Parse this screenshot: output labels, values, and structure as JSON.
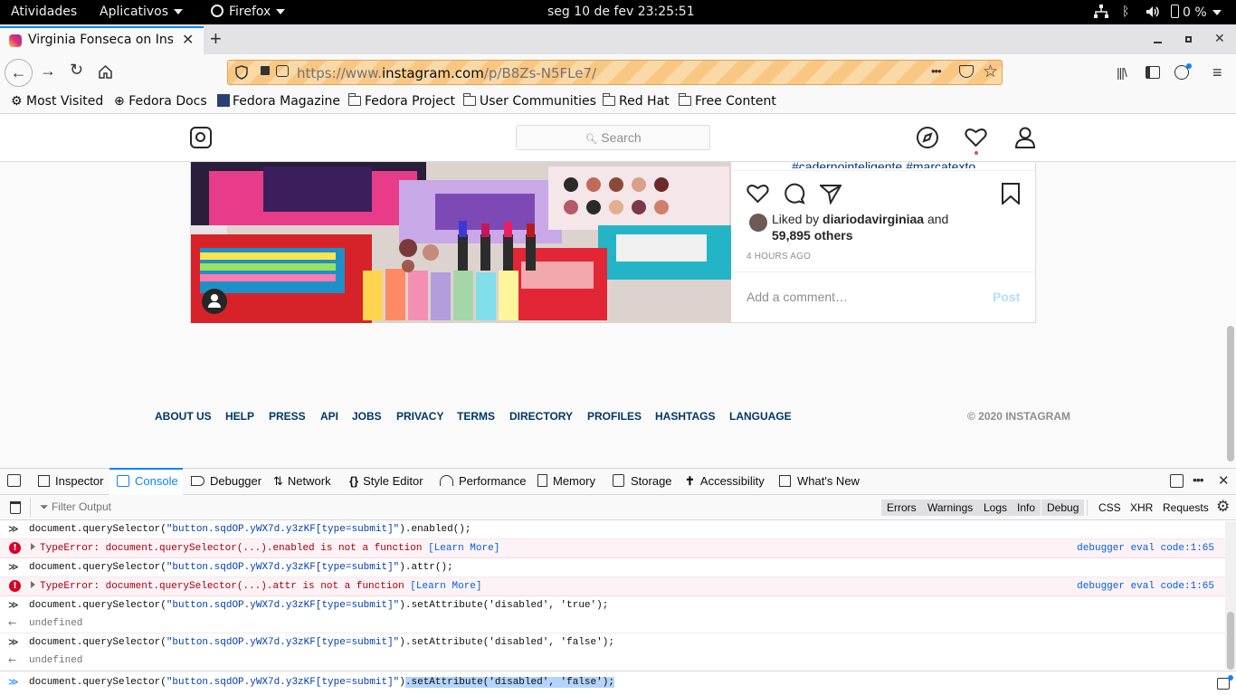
{
  "system_bar": {
    "activities": "Atividades",
    "applications": "Aplicativos",
    "app": "Firefox",
    "clock": "seg 10 de fev  23:25:51",
    "battery": "0 %"
  },
  "browser": {
    "tab_title": "Virginia Fonseca on Insta",
    "url_prefix": "https://www.",
    "url_domain": "instagram.com",
    "url_path": "/p/B8Zs-N5FLe7/",
    "page_actions": "•••",
    "bookmarks": [
      "Most Visited",
      "Fedora Docs",
      "Fedora Magazine",
      "Fedora Project",
      "User Communities",
      "Red Hat",
      "Free Content"
    ]
  },
  "instagram": {
    "search_placeholder": "Search",
    "caption_fragment": "#cadernointeligente #marcatexto",
    "liked_by_prefix": "Liked by ",
    "liked_by_user": "diariodavirginiaa",
    "liked_by_and": " and",
    "likes_others": "59,895 others",
    "timestamp": "4 HOURS AGO",
    "comment_placeholder": "Add a comment…",
    "post_button": "Post",
    "footer_links": [
      "ABOUT US",
      "HELP",
      "PRESS",
      "API",
      "JOBS",
      "PRIVACY",
      "TERMS",
      "DIRECTORY",
      "PROFILES",
      "HASHTAGS",
      "LANGUAGE"
    ],
    "copyright": "© 2020 INSTAGRAM"
  },
  "devtools": {
    "tabs": [
      "Inspector",
      "Console",
      "Debugger",
      "Network",
      "Style Editor",
      "Performance",
      "Memory",
      "Storage",
      "Accessibility",
      "What's New"
    ],
    "active_tab": "Console",
    "filter_placeholder": "Filter Output",
    "filter_buttons": [
      "Errors",
      "Warnings",
      "Logs",
      "Info",
      "Debug"
    ],
    "request_buttons": [
      "CSS",
      "XHR",
      "Requests"
    ],
    "console": [
      {
        "kind": "input",
        "pre": "document.querySelector(",
        "str": "\"button.sqdOP.yWX7d.y3zKF[type=submit]\"",
        "post": ").enabled();"
      },
      {
        "kind": "error",
        "text": "TypeError: document.querySelector(...).enabled is not a function",
        "learn": "[Learn More]",
        "location": "debugger eval code:1:65"
      },
      {
        "kind": "input",
        "pre": "document.querySelector(",
        "str": "\"button.sqdOP.yWX7d.y3zKF[type=submit]\"",
        "post": ").attr();"
      },
      {
        "kind": "error",
        "text": "TypeError: document.querySelector(...).attr is not a function",
        "learn": "[Learn More]",
        "location": "debugger eval code:1:65"
      },
      {
        "kind": "input",
        "pre": "document.querySelector(",
        "str": "\"button.sqdOP.yWX7d.y3zKF[type=submit]\"",
        "post": ").setAttribute('disabled', 'true');"
      },
      {
        "kind": "output",
        "text": "undefined"
      },
      {
        "kind": "input",
        "pre": "document.querySelector(",
        "str": "\"button.sqdOP.yWX7d.y3zKF[type=submit]\"",
        "post": ").setAttribute('disabled', 'false');"
      },
      {
        "kind": "output",
        "text": "undefined"
      }
    ],
    "input_line": {
      "pre": "document.querySelector(",
      "str": "\"button.sqdOP.yWX7d.y3zKF[type=submit]\"",
      "post": ")",
      "selected": ".setAttribute('disabled', 'false');"
    }
  }
}
